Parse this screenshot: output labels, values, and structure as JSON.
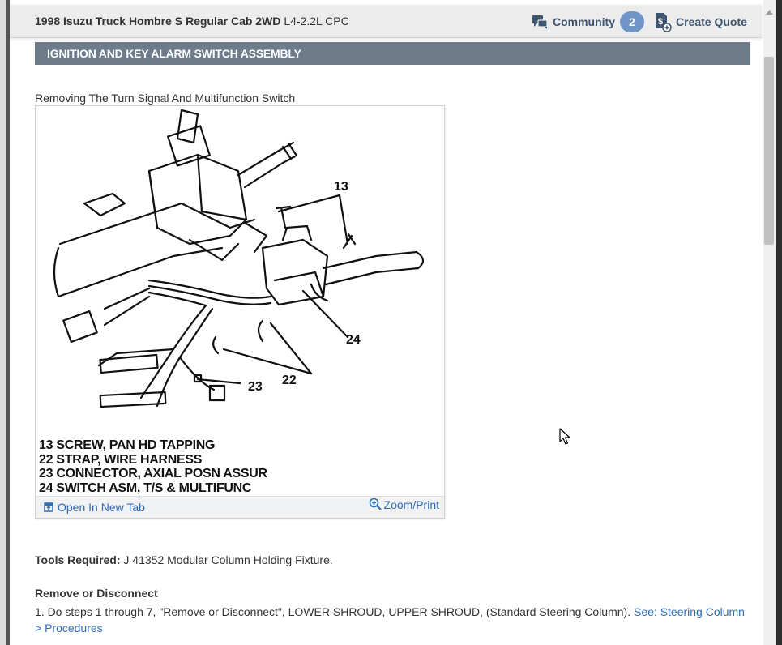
{
  "header": {
    "vehicle_bold": "1998 Isuzu Truck Hombre S Regular Cab 2WD",
    "vehicle_engine": "L4-2.2L CPC",
    "community_label": "Community",
    "community_count": "2",
    "quote_label": "Create Quote"
  },
  "section": {
    "title": "IGNITION AND KEY ALARM SWITCH ASSEMBLY"
  },
  "figure": {
    "caption": "Removing The Turn Signal And Multifunction Switch",
    "callouts": [
      "13",
      "24",
      "22",
      "23"
    ],
    "legend": [
      "13 SCREW, PAN HD TAPPING",
      "22 STRAP, WIRE HARNESS",
      "23 CONNECTOR, AXIAL POSN ASSUR",
      "24 SWITCH ASM, T/S & MULTIFUNC"
    ],
    "open_tab_label": "Open In New Tab",
    "zoom_label": "Zoom/Print"
  },
  "body": {
    "tools_label": "Tools Required:",
    "tools_value": "J 41352 Modular Column Holding Fixture.",
    "remove_heading": "Remove or Disconnect",
    "step1_text": "1. Do steps 1 through 7, \"Remove or Disconnect\", LOWER SHROUD, UPPER SHROUD, (Standard Steering Column).",
    "step1_link": "See: Steering Column > Procedures"
  },
  "colors": {
    "accent_link": "#2f6db5",
    "section_bar": "#6d7b8a",
    "badge": "#6f94c6"
  },
  "icons": {
    "community": "chat-bubbles-icon",
    "quote": "dollar-document-icon",
    "open_tab": "open-new-tab-icon",
    "zoom": "magnifier-plus-icon"
  }
}
